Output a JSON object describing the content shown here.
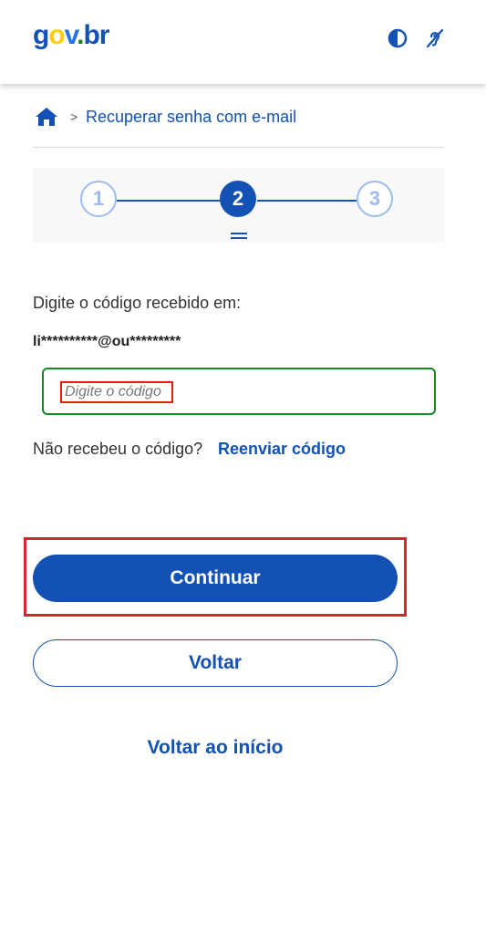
{
  "header": {
    "logo": {
      "part1": "g",
      "part2": "o",
      "part3": "v",
      "part4": ".",
      "part5": "br"
    },
    "contrast_icon": "contrast-icon",
    "accessibility_icon": "hearing-accessibility-icon"
  },
  "breadcrumb": {
    "home_icon": "home-icon",
    "separator": ">",
    "current": "Recuperar senha com e-mail"
  },
  "stepper": {
    "steps": [
      {
        "label": "1",
        "state": "inactive"
      },
      {
        "label": "2",
        "state": "active"
      },
      {
        "label": "3",
        "state": "inactive"
      }
    ]
  },
  "form": {
    "instruction": "Digite o código recebido em:",
    "masked_email": "li**********@ou*********",
    "code_input": {
      "value": "",
      "placeholder": "Digite o código"
    },
    "resend_question": "Não recebeu o código?",
    "resend_link": "Reenviar código"
  },
  "actions": {
    "continue_label": "Continuar",
    "back_label": "Voltar",
    "home_label": "Voltar ao início"
  },
  "colors": {
    "primary": "#1351b4",
    "success_border": "#168821",
    "highlight": "#d6262b",
    "step_inactive": "#9bbcf0"
  }
}
